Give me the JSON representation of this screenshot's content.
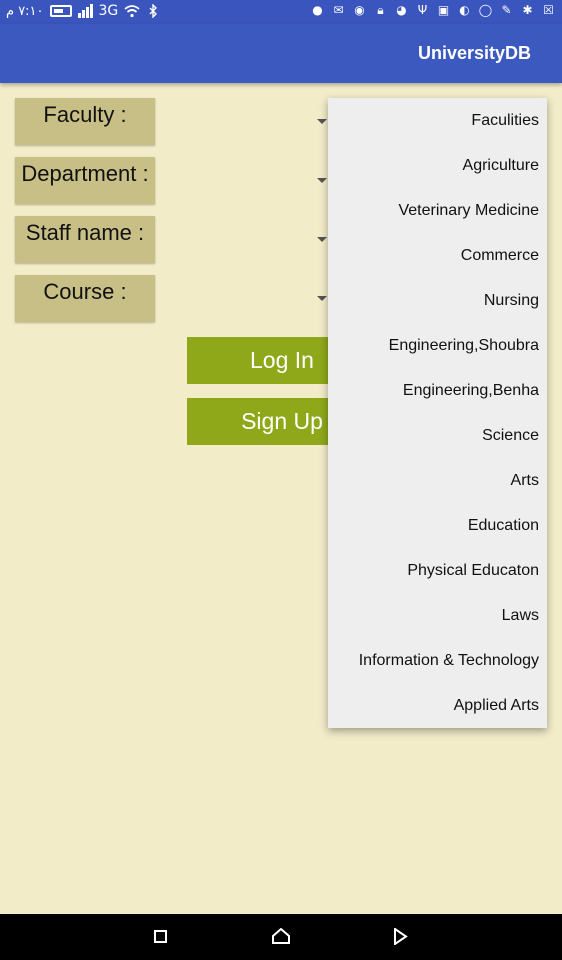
{
  "status_bar": {
    "time": "٧:١٠ م",
    "network": "3G",
    "icons_left": [
      "battery-icon",
      "signal-icon",
      "wifi-icon",
      "bluetooth-icon"
    ],
    "icons_right": [
      "notification-icon",
      "mail-icon",
      "chrome-icon",
      "lock-icon",
      "messenger-icon",
      "usb-icon",
      "image-icon",
      "app-icon",
      "whatsapp-icon",
      "wrench-icon",
      "settings-icon",
      "close-box-icon"
    ]
  },
  "app_bar": {
    "title": "UniversityDB"
  },
  "form": {
    "faculty_label": "Faculty :",
    "department_label": "Department :",
    "staff_label": "Staff name :",
    "course_label": "Course :"
  },
  "buttons": {
    "login": "Log In",
    "signup": "Sign Up"
  },
  "dropdown": {
    "items": [
      "Faculities",
      "Agriculture",
      "Veterinary Medicine",
      "Commerce",
      "Nursing",
      "Engineering,Shoubra",
      "Engineering,Benha",
      "Science",
      "Arts",
      "Education",
      "Physical Educaton",
      "Laws",
      "Information & Technology",
      "Applied Arts"
    ]
  },
  "colors": {
    "app_bar": "#3c59c0",
    "background": "#f2ecc9",
    "label_bg": "#c8bf87",
    "button_bg": "#8fa81a",
    "dropdown_bg": "#eeeeee"
  }
}
